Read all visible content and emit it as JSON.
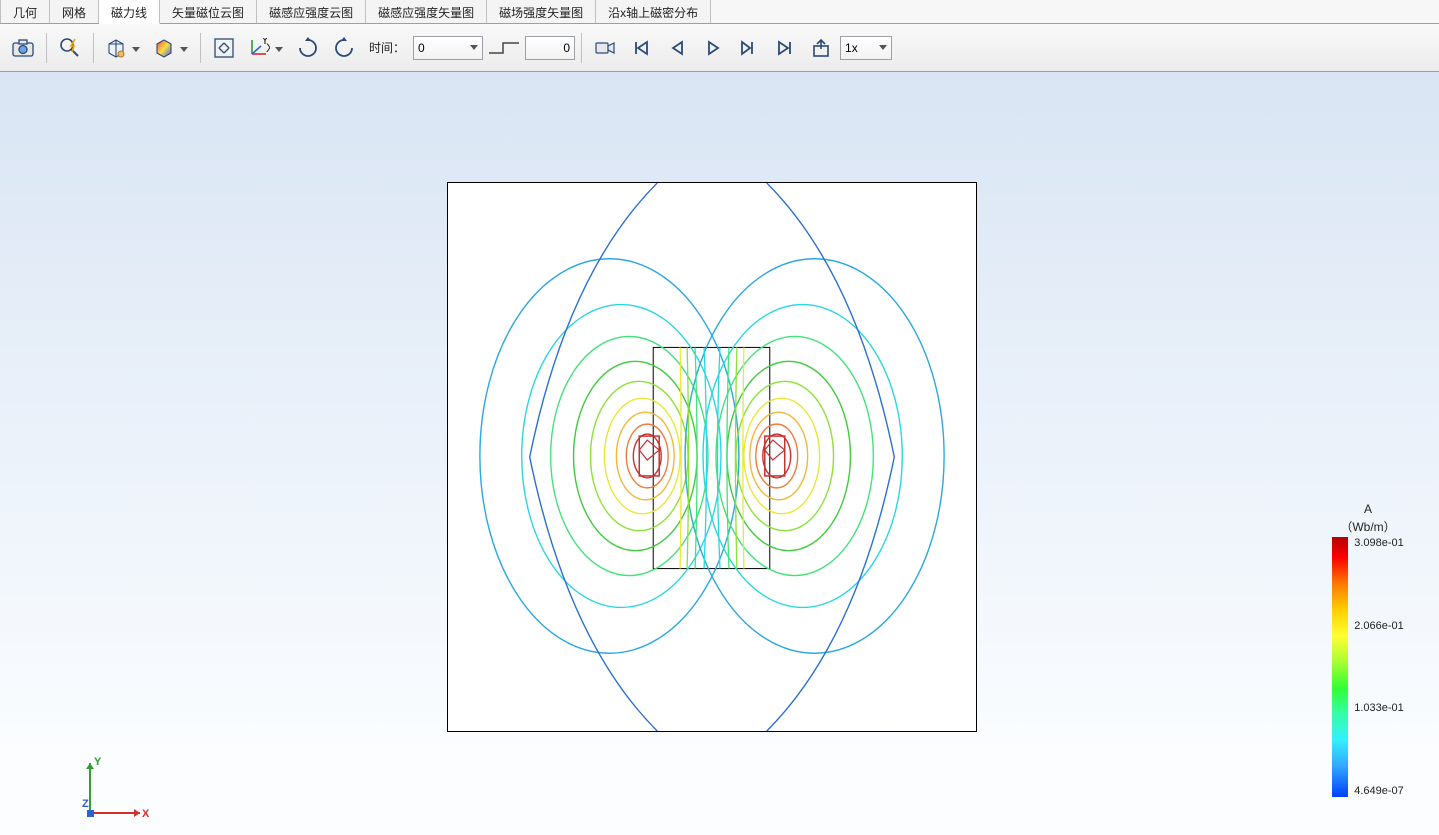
{
  "tabs": [
    {
      "label": "几何",
      "active": false
    },
    {
      "label": "网格",
      "active": false
    },
    {
      "label": "磁力线",
      "active": true
    },
    {
      "label": "矢量磁位云图",
      "active": false
    },
    {
      "label": "磁感应强度云图",
      "active": false
    },
    {
      "label": "磁感应强度矢量图",
      "active": false
    },
    {
      "label": "磁场强度矢量图",
      "active": false
    },
    {
      "label": "沿x轴上磁密分布",
      "active": false
    }
  ],
  "toolbar": {
    "time_label": "时间：",
    "time_value": "0",
    "frame_value": "0",
    "speed_value": "1x"
  },
  "triad": {
    "x": "X",
    "y": "Y",
    "z": "Z"
  },
  "legend": {
    "title_line1": "A",
    "title_line2": "（Wb/m）",
    "ticks": [
      "3.098e-01",
      "2.066e-01",
      "1.033e-01",
      "4.649e-07"
    ]
  },
  "chart_data": {
    "type": "contour",
    "quantity": "Magnetic vector potential A",
    "unit": "Wb/m",
    "value_range": [
      4.649e-07,
      0.3098
    ],
    "colorbar_ticks": [
      0.3098,
      0.2066,
      0.1033,
      4.649e-07
    ],
    "domain": {
      "outer_box": {
        "xmin": -1.0,
        "xmax": 1.0,
        "ymin": -1.0,
        "ymax": 1.0,
        "note": "normalized coordinates of outer square"
      },
      "iron_box": {
        "xmin": -0.22,
        "xmax": 0.22,
        "ymin": -0.39,
        "ymax": 0.41,
        "note": "normalized coordinates of inner rectangle"
      },
      "coil_left": {
        "xmin": -0.12,
        "xmax": -0.06,
        "ymin": -0.07,
        "ymax": 0.07
      },
      "coil_right": {
        "xmin": 0.06,
        "xmax": 0.12,
        "ymin": -0.07,
        "ymax": 0.07
      }
    },
    "contours": {
      "count": 10,
      "colors_outer_to_inner": [
        "#2a6fd6",
        "#2aa8e0",
        "#2ad6e0",
        "#42e27a",
        "#3ecb3e",
        "#8de03a",
        "#e8e83a",
        "#f2b83a",
        "#f27a3a",
        "#c73030"
      ],
      "note": "concentric oval field-line contours centred on each coil, mirrored left/right, inner contours spaced ~0.03 apart, outer spacing widens"
    }
  }
}
